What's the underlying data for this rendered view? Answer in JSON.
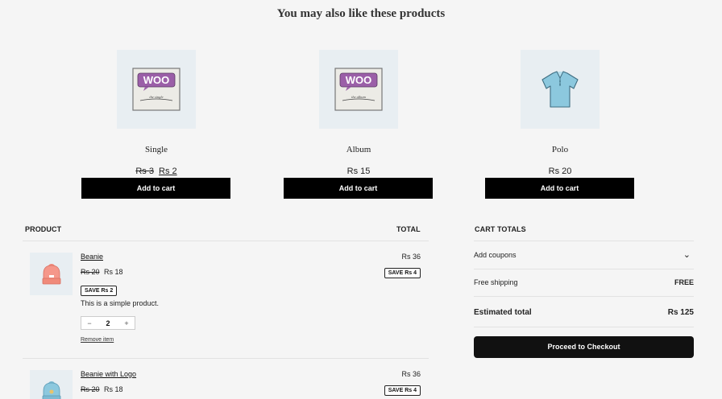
{
  "section_title": "You may also like these products",
  "products": [
    {
      "name": "Single",
      "price_old": "Rs 3",
      "price": "Rs 2",
      "button": "Add to cart",
      "image": "woo-single-icon"
    },
    {
      "name": "Album",
      "price_old": "",
      "price": "Rs 15",
      "button": "Add to cart",
      "image": "woo-album-icon"
    },
    {
      "name": "Polo",
      "price_old": "",
      "price": "Rs 20",
      "button": "Add to cart",
      "image": "polo-shirt-icon"
    }
  ],
  "cart": {
    "col_product": "PRODUCT",
    "col_total": "TOTAL",
    "items": [
      {
        "name": "Beanie",
        "price_old": "Rs 20",
        "price": "Rs 18",
        "save": "SAVE Rs 2",
        "description": "This is a simple product.",
        "qty_minus": "−",
        "qty": "2",
        "qty_plus": "+",
        "remove": "Remove item",
        "line_total": "Rs 36",
        "line_save": "SAVE Rs 4",
        "image": "beanie-orange-icon"
      },
      {
        "name": "Beanie with Logo",
        "price_old": "Rs 20",
        "price": "Rs 18",
        "line_total": "Rs 36",
        "line_save": "SAVE Rs 4",
        "image": "beanie-blue-icon"
      }
    ]
  },
  "totals": {
    "heading": "CART TOTALS",
    "coupons": "Add coupons",
    "coupons_chevron": "⌄",
    "shipping_label": "Free shipping",
    "shipping_value": "FREE",
    "estimated_label": "Estimated total",
    "estimated_value": "Rs 125",
    "checkout": "Proceed to Checkout"
  }
}
